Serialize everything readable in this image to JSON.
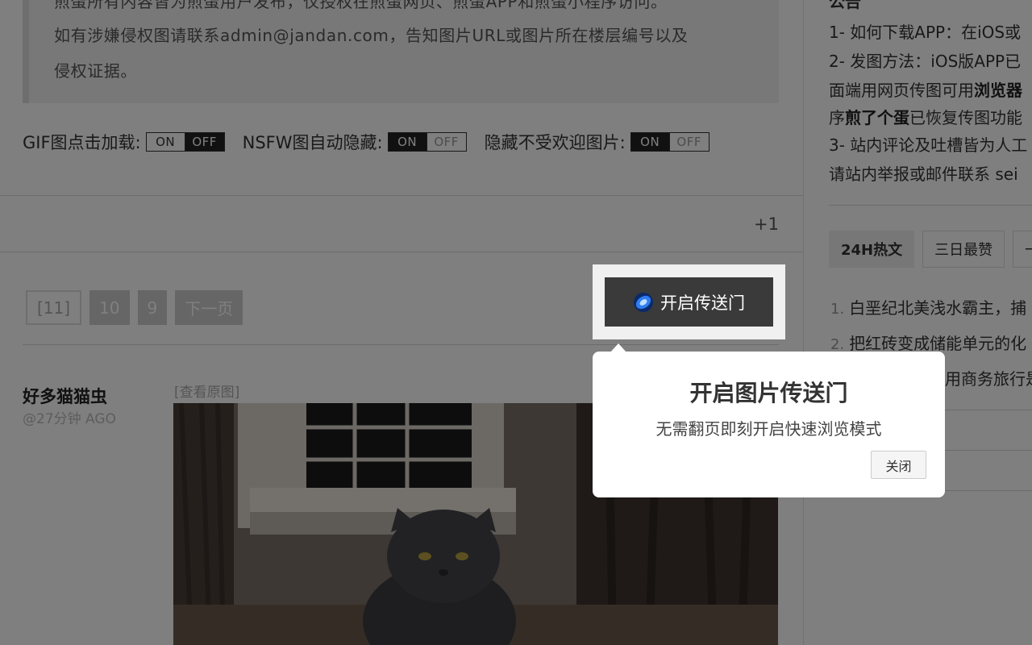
{
  "notice": {
    "line1": "煎蛋所有内容皆为煎蛋用户发布，仅授权在煎蛋网页、煎蛋APP和煎蛋小程序访问。",
    "line2": "如有涉嫌侵权图请联系admin@jandan.com，告知图片URL或图片所在楼层编号以及",
    "line3": "侵权证据。"
  },
  "toggles": [
    {
      "label": "GIF图点击加载:",
      "on": "ON",
      "off": "OFF",
      "state": "off"
    },
    {
      "label": "NSFW图自动隐藏:",
      "on": "ON",
      "off": "OFF",
      "state": "on"
    },
    {
      "label": "隐藏不受欢迎图片:",
      "on": "ON",
      "off": "OFF",
      "state": "on"
    }
  ],
  "plus_one": "+1",
  "pager": {
    "current": "[11]",
    "pages": [
      "10",
      "9"
    ],
    "next": "下一页"
  },
  "post": {
    "author": "好多猫猫虫",
    "time": "@27分钟 AGO",
    "view_original": "[查看原图]"
  },
  "sidebar": {
    "announce_title": "公告",
    "lines": [
      {
        "text": "1- 如何下载APP：在iOS或"
      },
      {
        "text": "2- 发图方法：iOS版APP已"
      },
      {
        "pre": "面端用网页传图可用",
        "bold": "浏览器"
      },
      {
        "bold": "煎了个蛋",
        "pre_b": "序",
        "post": "已恢复传图功能"
      },
      {
        "text": "3- 站内评论及吐槽皆为人工"
      },
      {
        "text": "请站内举报或邮件联系 sei"
      }
    ],
    "tabs": [
      "24H热文",
      "三日最赞",
      "一"
    ],
    "hot": [
      {
        "num": "1.",
        "text": "白垩纪北美浅水霸主，捕"
      },
      {
        "num": "2.",
        "text": "把红砖变成储能单元的化"
      },
      {
        "num": "",
        "text": "用商务旅行是"
      }
    ]
  },
  "portal": {
    "button_label": "开启传送门"
  },
  "popup": {
    "title": "开启图片传送门",
    "description": "无需翻页即刻开启快速浏览模式",
    "close_label": "关闭"
  }
}
